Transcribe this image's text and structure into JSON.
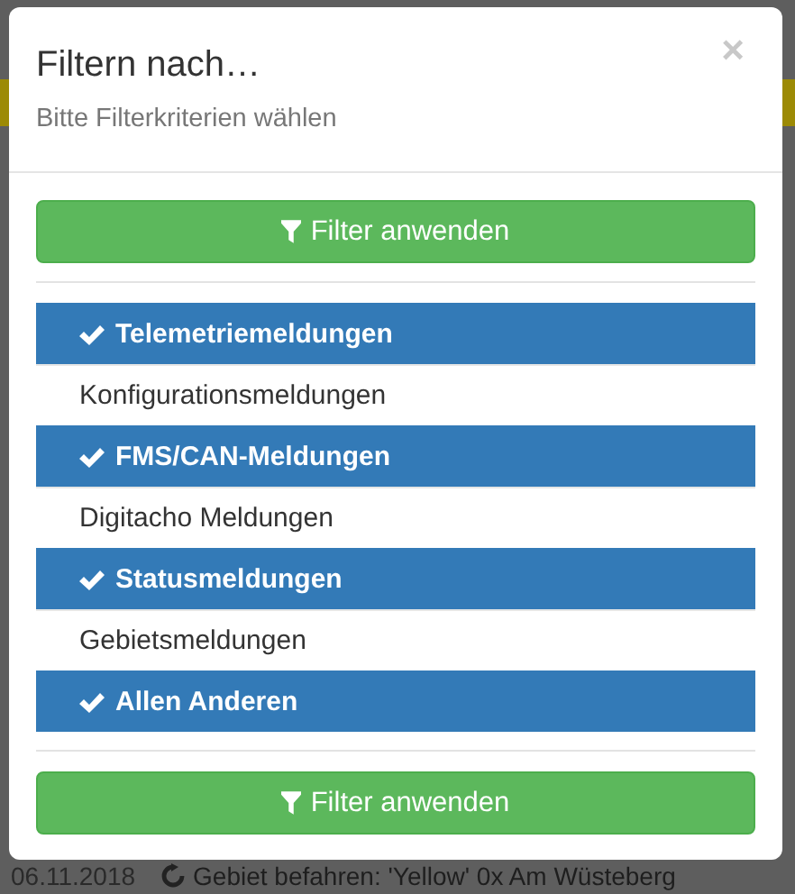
{
  "dialog": {
    "title": "Filtern nach…",
    "subtitle": "Bitte Filterkriterien wählen",
    "close": "×",
    "apply_button_top": "Filter anwenden",
    "filters": [
      {
        "label": "Telemetriemeldungen",
        "checked": true
      },
      {
        "label": "Konfigurationsmeldungen",
        "checked": false
      },
      {
        "label": "FMS/CAN-Meldungen",
        "checked": true
      },
      {
        "label": "Digitacho Meldungen",
        "checked": false
      },
      {
        "label": "Statusmeldungen",
        "checked": true
      },
      {
        "label": "Gebietsmeldungen",
        "checked": false
      },
      {
        "label": "Allen Anderen",
        "checked": true
      }
    ],
    "apply_button_bottom": "Filter anwenden"
  },
  "background_row": {
    "date": "06.11.2018",
    "message": "Gebiet befahren: 'Yellow' 0x Am Wüsteberg"
  }
}
